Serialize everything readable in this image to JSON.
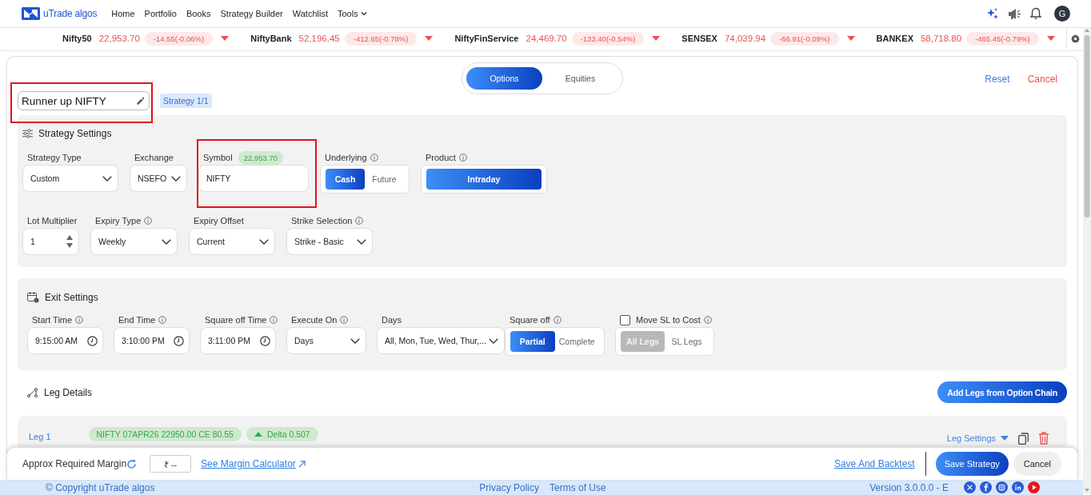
{
  "nav": {
    "brand": "uTrade algos",
    "links": [
      {
        "label": "Home",
        "dropdown": false
      },
      {
        "label": "Portfolio",
        "dropdown": false
      },
      {
        "label": "Books",
        "dropdown": false
      },
      {
        "label": "Strategy Builder",
        "dropdown": false
      },
      {
        "label": "Watchlist",
        "dropdown": false
      },
      {
        "label": "Tools",
        "dropdown": true
      }
    ],
    "avatar": "G"
  },
  "ticker": [
    {
      "name": "Nifty50",
      "price": "22,953.70",
      "change": "-14.55(-0.06%)",
      "falling": true
    },
    {
      "name": "NiftyBank",
      "price": "52,196.45",
      "change": "-412.65(-0.78%)",
      "falling": true
    },
    {
      "name": "NiftyFinService",
      "price": "24,469.70",
      "change": "-133.40(-0.54%)",
      "falling": true
    },
    {
      "name": "SENSEX",
      "price": "74,039.94",
      "change": "-66.91(-0.09%)",
      "falling": true
    },
    {
      "name": "BANKEX",
      "price": "58,718.80",
      "change": "-465.45(-0.79%)",
      "falling": true
    }
  ],
  "mode_tabs": [
    {
      "label": "Options",
      "selected": true
    },
    {
      "label": "Equities",
      "selected": false
    }
  ],
  "actions": [
    {
      "label": "Reset",
      "kind": "reset"
    },
    {
      "label": "Cancel",
      "kind": "cancel"
    }
  ],
  "strategy": {
    "name": "Runner up NIFTY",
    "badge": "Strategy 1/1",
    "highlighted": true
  },
  "strategy_settings": {
    "title": "Strategy Settings",
    "rows": [
      [
        {
          "label": "Strategy Type",
          "info": false,
          "kind": "select",
          "value": "Custom"
        },
        {
          "label": "Exchange",
          "info": false,
          "kind": "select",
          "value": "NSEFO"
        },
        {
          "label": "Symbol",
          "info": false,
          "badge": "22,953.70",
          "kind": "text",
          "value": "NIFTY",
          "highlighted": true
        },
        {
          "label": "Underlying",
          "info": true,
          "kind": "toggle",
          "options": [
            {
              "label": "Cash",
              "selected": true
            },
            {
              "label": "Future",
              "selected": false
            }
          ]
        },
        {
          "label": "Product",
          "info": true,
          "kind": "toggle",
          "options": [
            {
              "label": "Intraday",
              "selected": true
            }
          ]
        }
      ],
      [
        {
          "label": "Lot Multiplier",
          "info": false,
          "kind": "number",
          "value": "1"
        },
        {
          "label": "Expiry Type",
          "info": true,
          "kind": "select",
          "value": "Weekly"
        },
        {
          "label": "Expiry Offset",
          "info": false,
          "kind": "select",
          "value": "Current"
        },
        {
          "label": "Strike Selection",
          "info": true,
          "kind": "select",
          "value": "Strike - Basic"
        }
      ]
    ]
  },
  "exit_settings": {
    "title": "Exit Settings",
    "fields": [
      {
        "label": "Start Time",
        "info": true,
        "kind": "time",
        "value": "9:15:00 AM"
      },
      {
        "label": "End Time",
        "info": true,
        "kind": "time",
        "value": "3:10:00 PM"
      },
      {
        "label": "Square off Time",
        "info": true,
        "kind": "time",
        "value": "3:11:00 PM"
      },
      {
        "label": "Execute On",
        "info": true,
        "kind": "select",
        "value": "Days"
      },
      {
        "label": "Days",
        "info": false,
        "kind": "select",
        "value": "All, Mon, Tue, Wed, Thur,..."
      },
      {
        "label": "Square off",
        "info": true,
        "kind": "toggle",
        "options": [
          {
            "label": "Partial",
            "selected": true
          },
          {
            "label": "Complete",
            "selected": false
          }
        ]
      },
      {
        "label": "Move SL to Cost",
        "info": true,
        "kind": "toggle",
        "checked": false,
        "options": [
          {
            "label": "All Legs",
            "selected": true
          },
          {
            "label": "SL Legs",
            "selected": false
          }
        ]
      }
    ]
  },
  "leg_details": {
    "title": "Leg Details",
    "add_button": "Add Legs from Option Chain",
    "legs": [
      {
        "label": "Leg 1",
        "contract": "NIFTY 07APR26 22950.00 CE 80.55",
        "delta": "Delta 0.507",
        "delta_falling": false,
        "settings": "Leg Settings"
      }
    ]
  },
  "action_bar": {
    "margin_label": "Approx Required Margin",
    "margin_value": "₹ --",
    "calculator_link": "See Margin Calculator",
    "buttons": [
      {
        "label": "Save And Backtest",
        "kind": "link"
      },
      {
        "label": "Save Strategy",
        "kind": "primary"
      },
      {
        "label": "Cancel",
        "kind": "secondary"
      }
    ]
  },
  "footer": {
    "copyright": "© Copyright uTrade algos",
    "links": [
      "Privacy Policy",
      "Terms of Use"
    ],
    "version": "Version 3.0.0.0 - E"
  }
}
